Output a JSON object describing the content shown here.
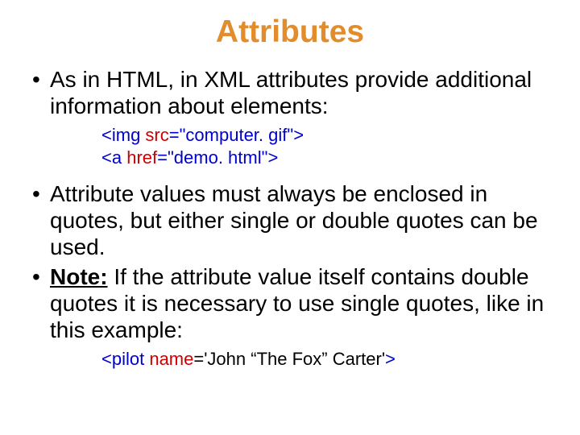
{
  "title": "Attributes",
  "bullet1": "As in HTML, in XML attributes provide additional information about elements:",
  "code1": {
    "lt1": "<",
    "tag1": "img",
    "attr1": " src",
    "eq1": "=\"computer. gif\"",
    "gt1": ">",
    "lt2": "<",
    "tag2": "a",
    "attr2": " href",
    "eq2": "=\"demo. html\"",
    "gt2": ">"
  },
  "bullet2": "Attribute values must always be enclosed in quotes, but either single or double quotes can be used.",
  "bullet3_note": "Note:",
  "bullet3_rest": " If the attribute value itself contains double quotes it is necessary to use single quotes, like in this example:",
  "code2": {
    "lt": "<",
    "tag": "pilot",
    "attr": " name",
    "val": "='John “The Fox” Carter'",
    "gt": ">"
  }
}
